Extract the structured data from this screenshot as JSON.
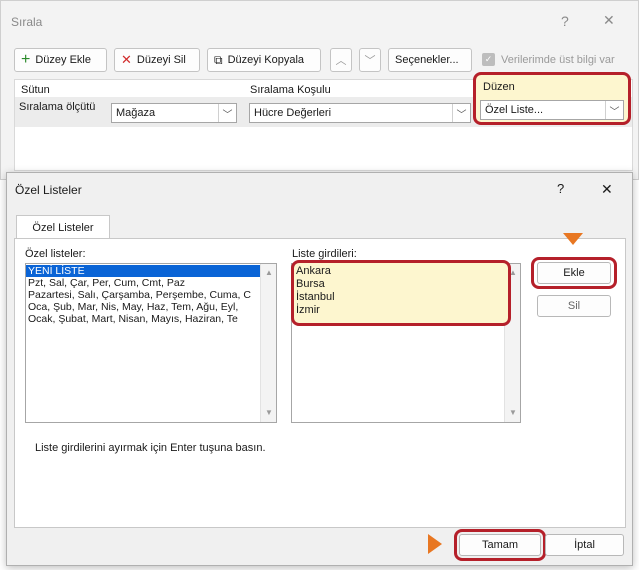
{
  "sort_dialog": {
    "title": "Sırala",
    "help": "?",
    "close": "✕",
    "toolbar": {
      "add_level": "Düzey Ekle",
      "delete_level": "Düzeyi Sil",
      "copy_level": "Düzeyi Kopyala",
      "options": "Seçenekler...",
      "has_headers": "Verilerimde üst bilgi var"
    },
    "columns": {
      "column": "Sütun",
      "sort_on": "Sıralama Koşulu",
      "order": "Düzen"
    },
    "row": {
      "label": "Sıralama ölçütü",
      "column_value": "Mağaza",
      "sort_on_value": "Hücre Değerleri",
      "order_value": "Özel Liste..."
    }
  },
  "custom_lists_dialog": {
    "title": "Özel Listeler",
    "help": "?",
    "close": "✕",
    "tab": "Özel Listeler",
    "lists_label": "Özel listeler:",
    "entries_label": "Liste girdileri:",
    "lists": [
      "YENİ LİSTE",
      "Pzt, Sal, Çar, Per, Cum, Cmt, Paz",
      "Pazartesi, Salı, Çarşamba, Perşembe, Cuma, C",
      "Oca, Şub, Mar, Nis, May, Haz, Tem, Ağu, Eyl,",
      "Ocak, Şubat, Mart, Nisan, Mayıs, Haziran, Te"
    ],
    "entries": [
      "Ankara",
      "Bursa",
      "İstanbul",
      "İzmir"
    ],
    "add_button": "Ekle",
    "delete_button": "Sil",
    "hint": "Liste girdilerini ayırmak için Enter tuşuna basın.",
    "ok_button": "Tamam",
    "cancel_button": "İptal"
  },
  "colors": {
    "highlight": "#b5202a",
    "arrow": "#e87722",
    "selection": "#0a64d6",
    "entry_bg": "#fdf6cf"
  }
}
